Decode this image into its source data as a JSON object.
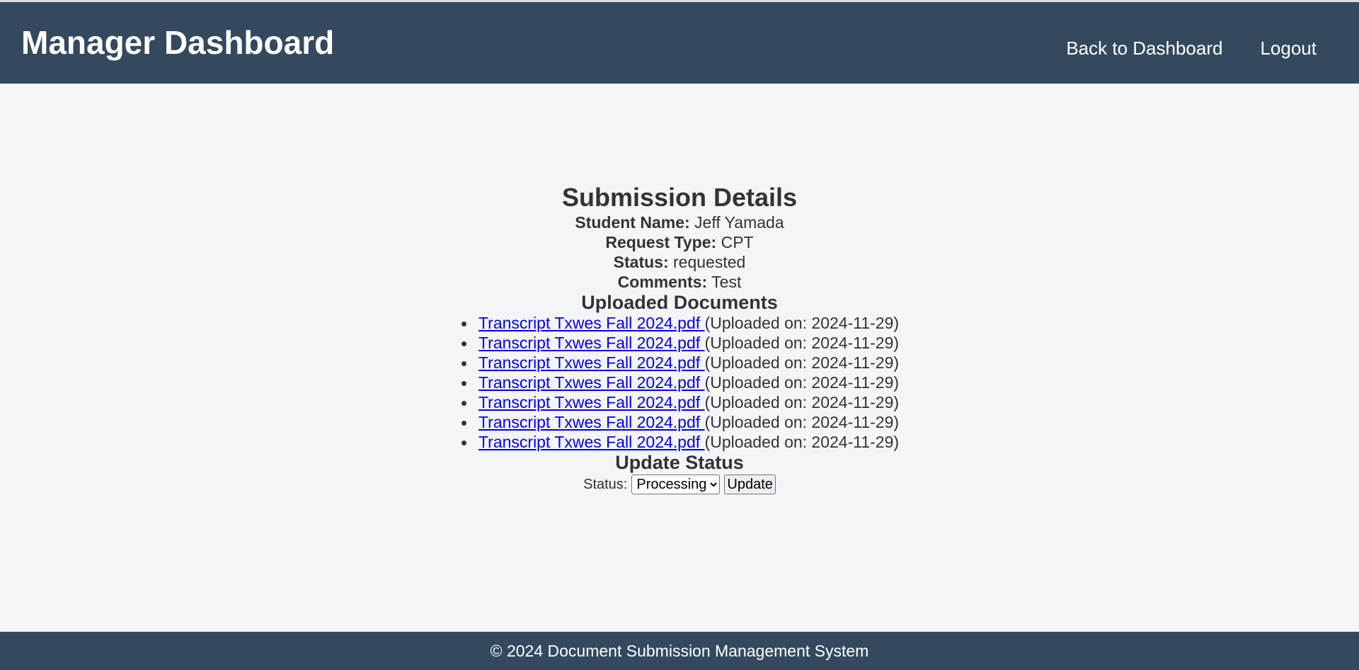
{
  "header": {
    "title": "Manager Dashboard",
    "nav": [
      {
        "label": "Back to Dashboard"
      },
      {
        "label": "Logout"
      }
    ]
  },
  "details": {
    "title": "Submission Details",
    "student_name_label": "Student Name:",
    "student_name": "Jeff Yamada",
    "request_type_label": "Request Type:",
    "request_type": "CPT",
    "status_label": "Status:",
    "status": "requested",
    "comments_label": "Comments:",
    "comments": "Test"
  },
  "documents": {
    "title": "Uploaded Documents",
    "items": [
      {
        "name": "Transcript Txwes Fall 2024.pdf ",
        "uploaded": "(Uploaded on: 2024-11-29)"
      },
      {
        "name": "Transcript Txwes Fall 2024.pdf ",
        "uploaded": "(Uploaded on: 2024-11-29)"
      },
      {
        "name": "Transcript Txwes Fall 2024.pdf ",
        "uploaded": "(Uploaded on: 2024-11-29)"
      },
      {
        "name": "Transcript Txwes Fall 2024.pdf ",
        "uploaded": "(Uploaded on: 2024-11-29)"
      },
      {
        "name": "Transcript Txwes Fall 2024.pdf ",
        "uploaded": "(Uploaded on: 2024-11-29)"
      },
      {
        "name": "Transcript Txwes Fall 2024.pdf ",
        "uploaded": "(Uploaded on: 2024-11-29)"
      },
      {
        "name": "Transcript Txwes Fall 2024.pdf ",
        "uploaded": "(Uploaded on: 2024-11-29)"
      }
    ]
  },
  "update_status": {
    "title": "Update Status",
    "label": "Status:",
    "selected": "Processing",
    "button": "Update"
  },
  "footer": {
    "text": "© 2024 Document Submission Management System"
  },
  "colors": {
    "header_bg": "#34495e",
    "page_bg": "#f4f5f9",
    "link": "#0000ee"
  }
}
